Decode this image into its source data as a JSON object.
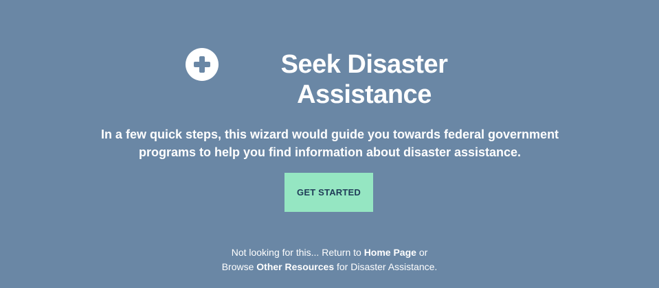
{
  "hero": {
    "icon": "plus-circle-icon",
    "title": "Seek Disaster Assistance",
    "subtitle": "In a few quick steps, this wizard would guide you towards federal government programs to help you find information about disaster assistance.",
    "cta_label": "GET STARTED"
  },
  "footer": {
    "line1_prefix": "Not looking for this... Return to ",
    "home_link": "Home Page",
    "line1_suffix": " or",
    "line2_prefix": "Browse ",
    "resources_link": "Other Resources",
    "line2_suffix": " for Disaster Assistance."
  },
  "colors": {
    "background": "#6a87a5",
    "button": "#95e6c2",
    "button_text": "#1f3b57",
    "text": "#ffffff"
  }
}
